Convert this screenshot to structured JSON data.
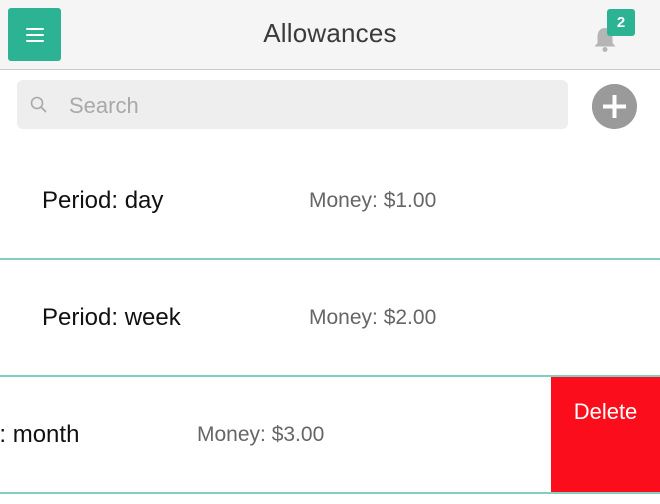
{
  "header": {
    "title": "Allowances",
    "menu_icon": "hamburger-menu-icon",
    "notification_icon": "bell-icon",
    "notification_count": "2",
    "accent_color": "#2bb394"
  },
  "search": {
    "placeholder": "Search",
    "value": "",
    "icon": "search-icon"
  },
  "add_button": {
    "icon": "plus-circle-icon"
  },
  "allowances": [
    {
      "period": "Period: day",
      "money": "Money: $1.00"
    },
    {
      "period": "Period: week",
      "money": "Money: $2.00"
    },
    {
      "period": "Period: month",
      "money": "Money: $3.00",
      "action_label": "Delete",
      "action_color": "#fc0d1b"
    }
  ]
}
